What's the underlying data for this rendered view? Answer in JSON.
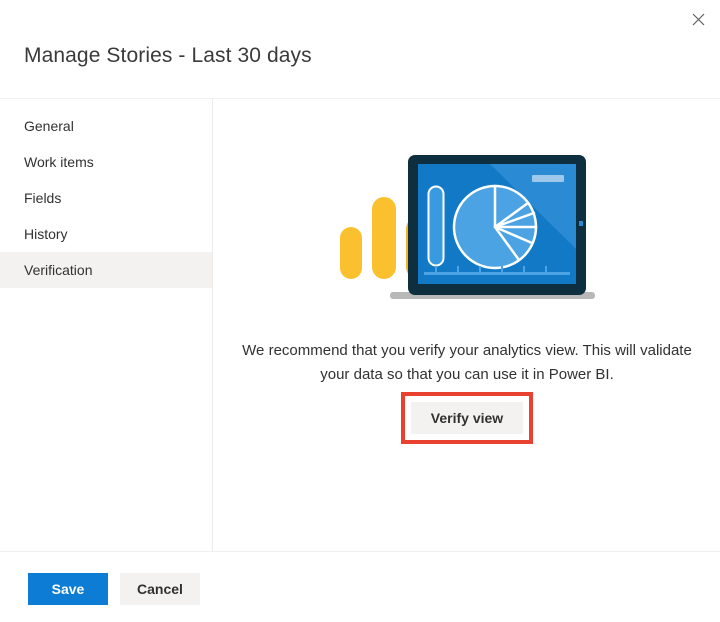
{
  "dialog": {
    "title": "Manage Stories - Last 30 days",
    "close_icon": "close-icon"
  },
  "nav": {
    "items": [
      {
        "label": "General",
        "selected": false
      },
      {
        "label": "Work items",
        "selected": false
      },
      {
        "label": "Fields",
        "selected": false
      },
      {
        "label": "History",
        "selected": false
      },
      {
        "label": "Verification",
        "selected": true
      }
    ]
  },
  "content": {
    "illustration_name": "analytics-dashboard-illustration",
    "message": "We recommend that you verify your analytics view. This will validate your data so that you can use it in Power BI.",
    "verify_button_label": "Verify view",
    "highlight_color": "#e8412f"
  },
  "footer": {
    "save_label": "Save",
    "cancel_label": "Cancel",
    "save_color": "#0c7cd5"
  }
}
